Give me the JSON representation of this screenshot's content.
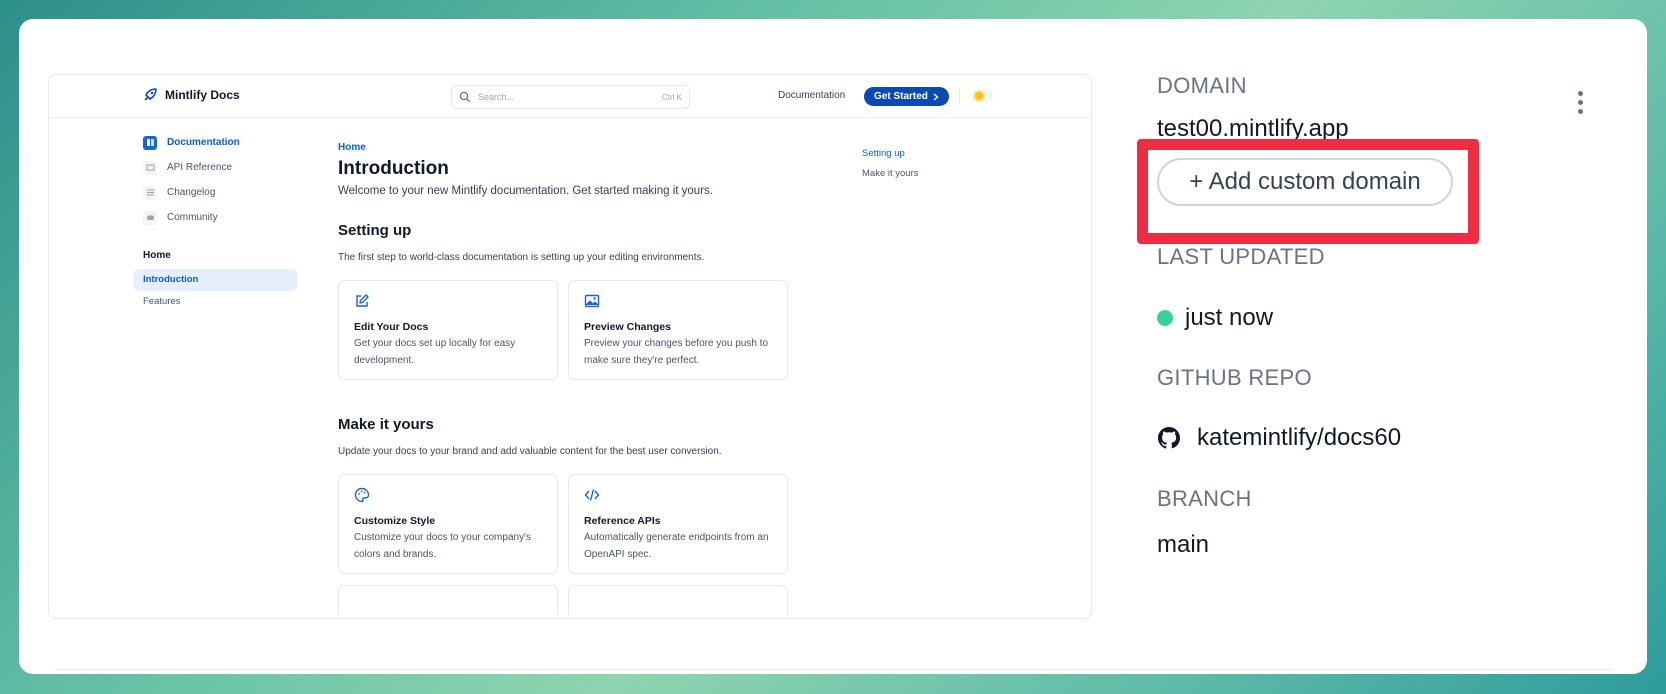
{
  "preview": {
    "logo_text": "Mintlify Docs",
    "search_placeholder": "Search...",
    "search_shortcut": "Ctrl K",
    "nav_documentation": "Documentation",
    "get_started": "Get Started",
    "sidebar": {
      "links": [
        {
          "label": "Documentation",
          "icon": "book-icon",
          "active": true
        },
        {
          "label": "API Reference",
          "icon": "api-icon",
          "active": false
        },
        {
          "label": "Changelog",
          "icon": "list-icon",
          "active": false
        },
        {
          "label": "Community",
          "icon": "discord-icon",
          "active": false
        }
      ],
      "section_title": "Home",
      "items": [
        {
          "label": "Introduction",
          "active": true
        },
        {
          "label": "Features",
          "active": false
        }
      ]
    },
    "content": {
      "breadcrumb": "Home",
      "title": "Introduction",
      "lead": "Welcome to your new Mintlify documentation. Get started making it yours.",
      "section1_title": "Setting up",
      "section1_text": "The first step to world-class documentation is setting up your editing environments.",
      "cards1": [
        {
          "icon": "pencil-square-icon",
          "title": "Edit Your Docs",
          "desc": "Get your docs set up locally for easy development."
        },
        {
          "icon": "image-icon",
          "title": "Preview Changes",
          "desc": "Preview your changes before you push to make sure they're perfect."
        }
      ],
      "section2_title": "Make it yours",
      "section2_text": "Update your docs to your brand and add valuable content for the best user conversion.",
      "cards2": [
        {
          "icon": "palette-icon",
          "title": "Customize Style",
          "desc": "Customize your docs to your company's colors and brands."
        },
        {
          "icon": "code-icon",
          "title": "Reference APIs",
          "desc": "Automatically generate endpoints from an OpenAPI spec."
        }
      ]
    },
    "toc": [
      {
        "label": "Setting up",
        "active": true
      },
      {
        "label": "Make it yours",
        "active": false
      }
    ]
  },
  "info": {
    "domain_label": "DOMAIN",
    "domain_value": "test00.mintlify.app",
    "add_domain_button": "+ Add custom domain",
    "last_updated_label": "LAST UPDATED",
    "last_updated_value": "just now",
    "github_label": "GITHUB REPO",
    "github_value": "katemintlify/docs60",
    "branch_label": "BRANCH",
    "branch_value": "main"
  },
  "colors": {
    "accent": "#0b4ab0",
    "highlight": "#ec2d44",
    "status_ok": "#34d399"
  }
}
